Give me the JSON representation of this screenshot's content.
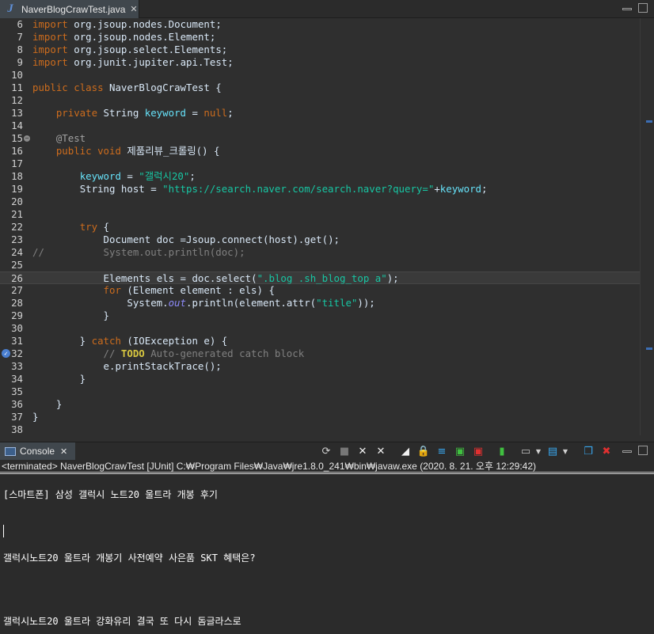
{
  "editor_tab": {
    "icon": "java-file-icon",
    "label": "NaverBlogCrawTest.java",
    "close": "✕"
  },
  "lines": [
    {
      "n": "6",
      "code": "import org.jsoup.nodes.Document;"
    },
    {
      "n": "7",
      "code": "import org.jsoup.nodes.Element;"
    },
    {
      "n": "8",
      "code": "import org.jsoup.select.Elements;"
    },
    {
      "n": "9",
      "code": "import org.junit.jupiter.api.Test;"
    },
    {
      "n": "10",
      "code": ""
    },
    {
      "n": "11",
      "code": "public class NaverBlogCrawTest {"
    },
    {
      "n": "12",
      "code": ""
    },
    {
      "n": "13",
      "code": "    private String keyword = null;"
    },
    {
      "n": "14",
      "code": ""
    },
    {
      "n": "15",
      "code": "    @Test"
    },
    {
      "n": "16",
      "code": "    public void 제품리뷰_크롤링() {"
    },
    {
      "n": "17",
      "code": ""
    },
    {
      "n": "18",
      "code": "        keyword = \"갤럭시20\";"
    },
    {
      "n": "19",
      "code": "        String host = \"https://search.naver.com/search.naver?query=\"+keyword;"
    },
    {
      "n": "20",
      "code": ""
    },
    {
      "n": "21",
      "code": ""
    },
    {
      "n": "22",
      "code": "        try {"
    },
    {
      "n": "23",
      "code": "            Document doc =Jsoup.connect(host).get();"
    },
    {
      "n": "24",
      "code": "//          System.out.println(doc);"
    },
    {
      "n": "25",
      "code": ""
    },
    {
      "n": "26",
      "code": "            Elements els = doc.select(\".blog .sh_blog_top a\");"
    },
    {
      "n": "27",
      "code": "            for (Element element : els) {"
    },
    {
      "n": "28",
      "code": "                System.out.println(element.attr(\"title\"));"
    },
    {
      "n": "29",
      "code": "            }"
    },
    {
      "n": "30",
      "code": ""
    },
    {
      "n": "31",
      "code": "        } catch (IOException e) {"
    },
    {
      "n": "32",
      "code": "            // TODO Auto-generated catch block"
    },
    {
      "n": "33",
      "code": "            e.printStackTrace();"
    },
    {
      "n": "34",
      "code": "        }"
    },
    {
      "n": "35",
      "code": ""
    },
    {
      "n": "36",
      "code": "    }"
    },
    {
      "n": "37",
      "code": "}"
    },
    {
      "n": "38",
      "code": ""
    }
  ],
  "console": {
    "tab_label": "Console",
    "tab_close": "✕",
    "status": "<terminated> NaverBlogCrawTest [JUnit] C:₩Program Files₩Java₩jre1.8.0_241₩bin₩javaw.exe (2020. 8. 21. 오후 12:29:42)",
    "output": [
      "[스마트폰] 삼성 갤럭시 노트20 울트라 개봉 후기",
      "갤럭시노트20 울트라 개봉기 사전예약 사은품 SKT 혜택은?",
      "갤럭시노트20 울트라 강화유리 결국 또 다시 돔글라스로"
    ],
    "toolbar_icons": [
      "refresh-icon",
      "stop-icon",
      "remove-launch-icon",
      "remove-all-terminated-icon",
      "clear-console-icon",
      "scroll-lock-icon",
      "word-wrap-icon",
      "show-stdout-icon",
      "show-stderr-icon",
      "pin-console-icon",
      "display-console-icon",
      "new-console-icon",
      "minimize-icon",
      "maximize-icon"
    ]
  },
  "colors": {
    "keyword": "#cc6c1d",
    "string": "#17c6a3",
    "field": "#66e1f8",
    "comment": "#808080",
    "todo": "#d8c740",
    "background": "#2f2f2f"
  }
}
